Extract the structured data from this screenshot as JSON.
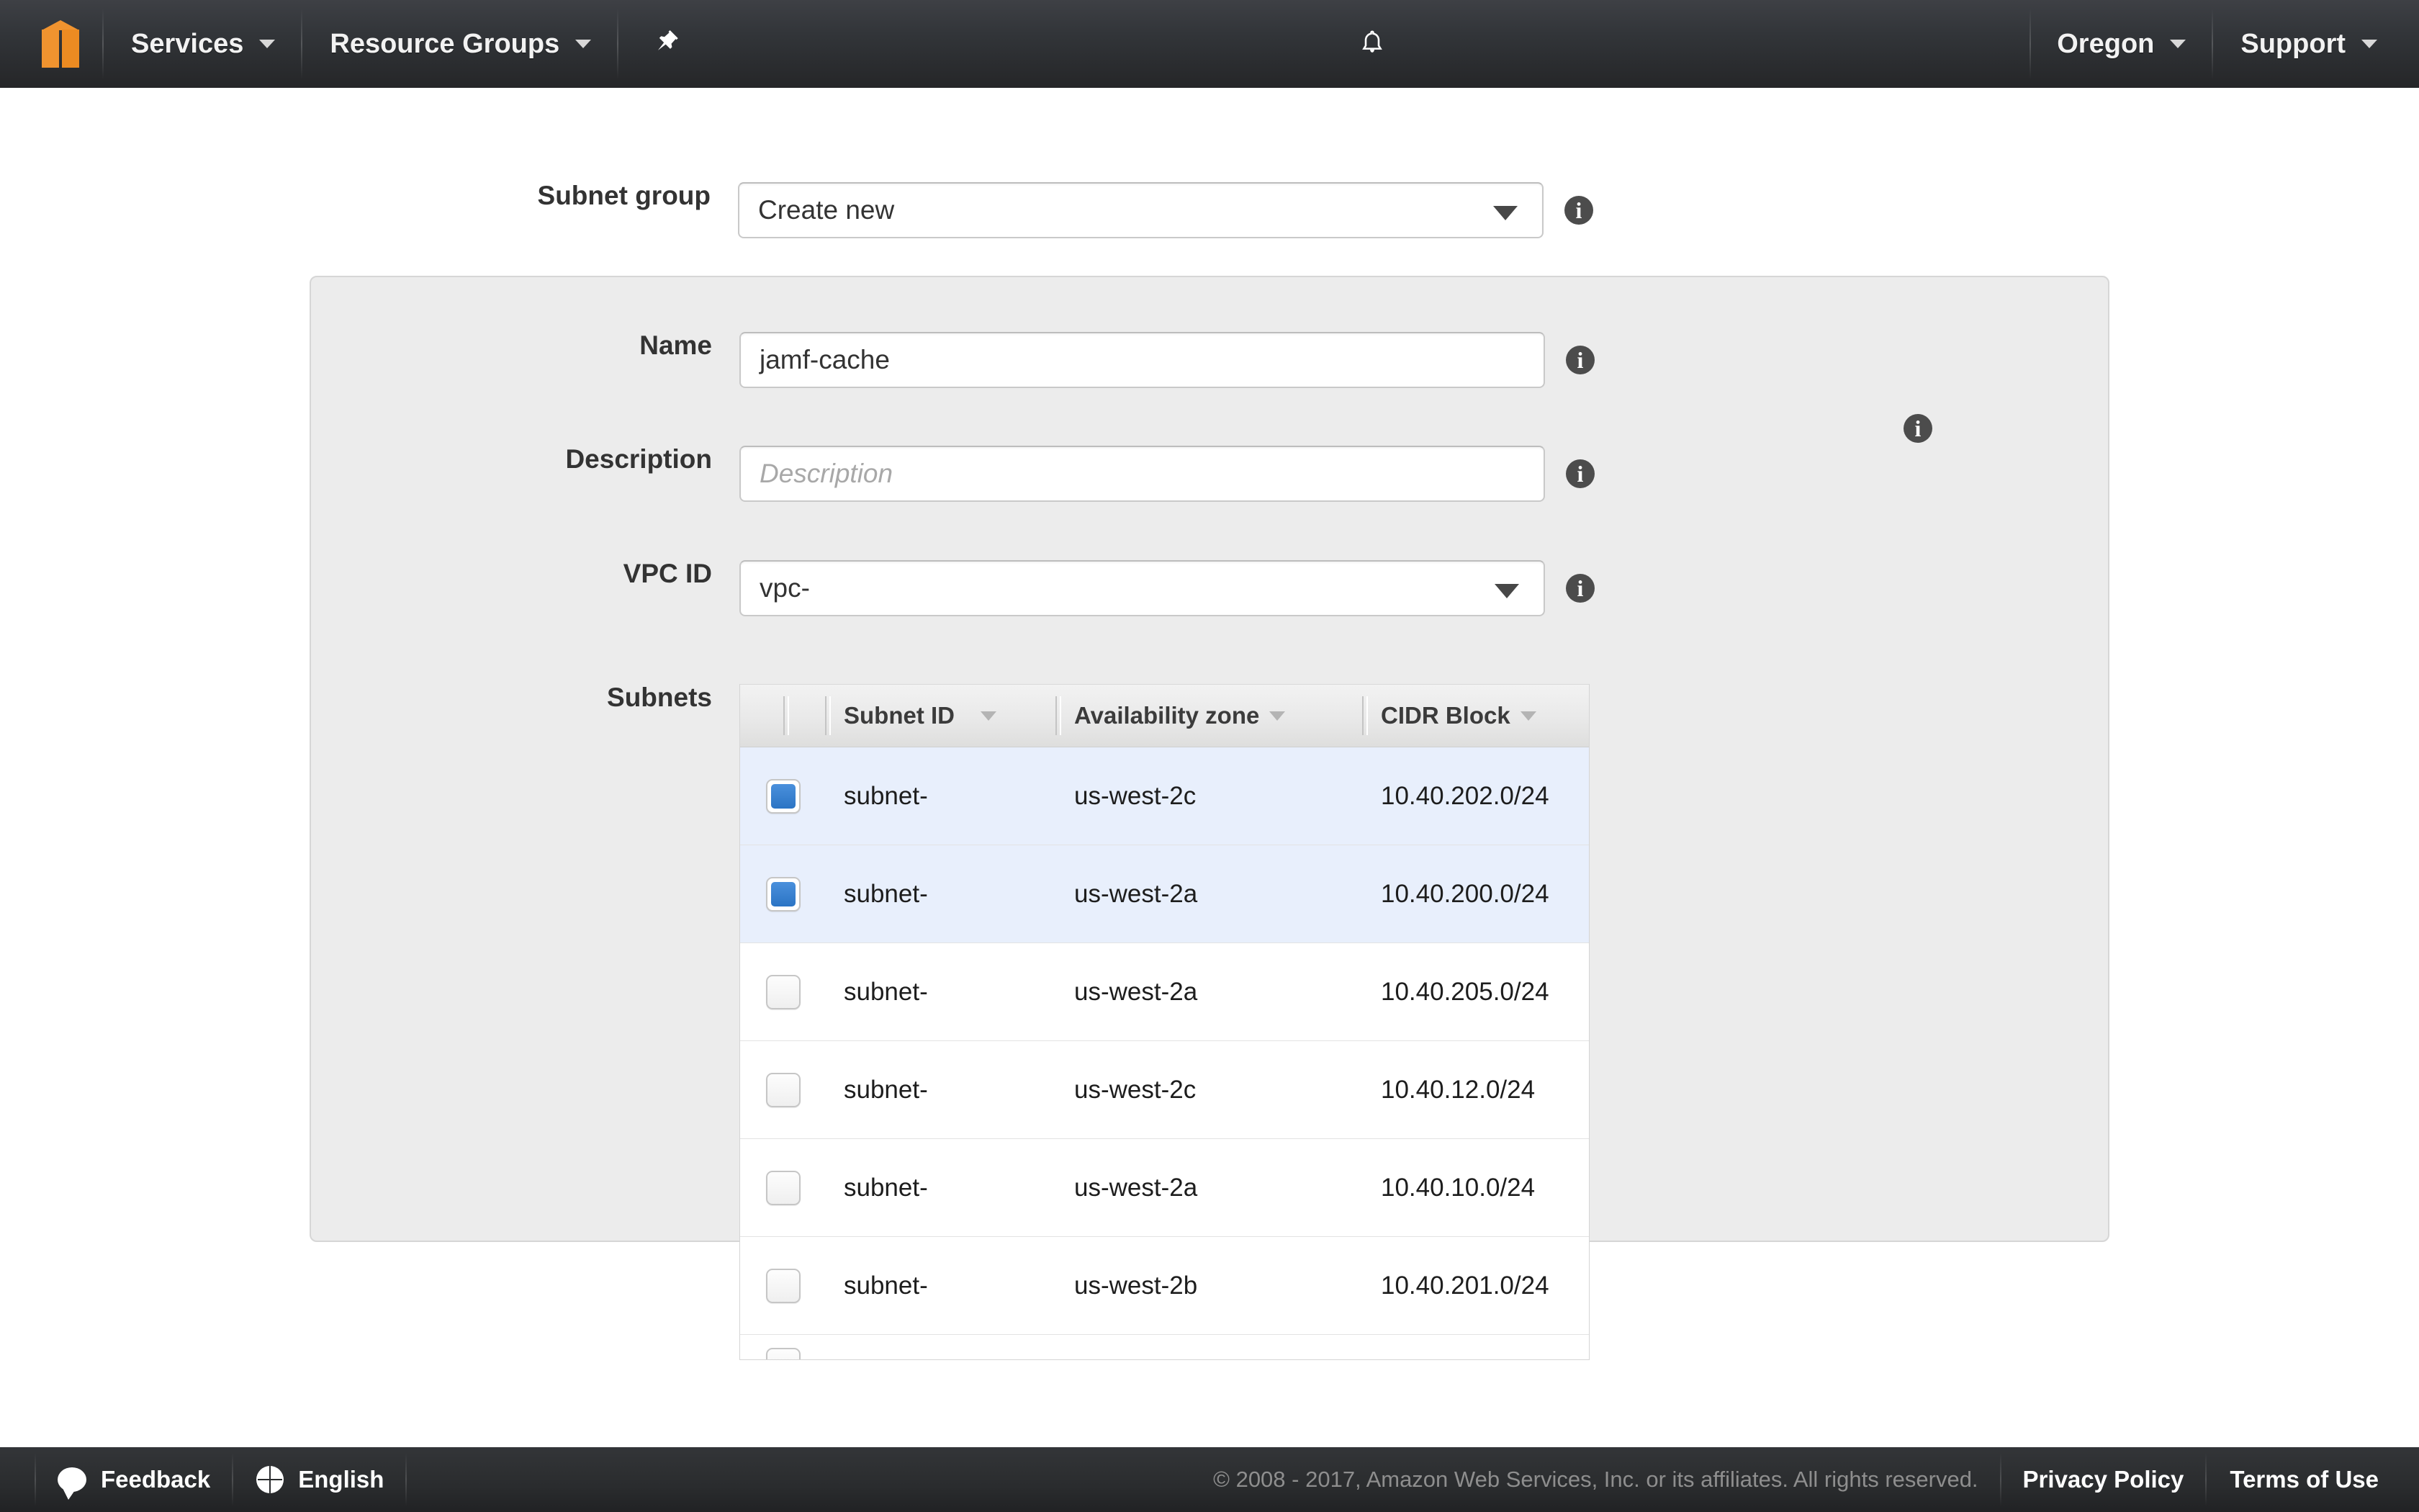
{
  "navbar": {
    "logo_icon": "aws-cube-logo",
    "services_label": "Services",
    "resource_groups_label": "Resource Groups",
    "pin_icon": "pushpin-icon",
    "bell_icon": "bell-notification-icon",
    "region_label": "Oregon",
    "support_label": "Support"
  },
  "form": {
    "subnet_group": {
      "label": "Subnet group",
      "value": "Create new",
      "info_icon": "info-icon"
    },
    "name": {
      "label": "Name",
      "value": "jamf-cache",
      "info_icon": "info-icon"
    },
    "description": {
      "label": "Description",
      "value": "",
      "placeholder": "Description",
      "info_icon": "info-icon"
    },
    "vpc_id": {
      "label": "VPC ID",
      "value": "vpc-",
      "info_icon": "info-icon"
    },
    "subnets": {
      "label": "Subnets",
      "info_icon": "info-icon"
    }
  },
  "subnets_table": {
    "columns": [
      {
        "key": "subnet_id",
        "label": "Subnet ID"
      },
      {
        "key": "availability_zone",
        "label": "Availability zone"
      },
      {
        "key": "cidr_block",
        "label": "CIDR Block"
      }
    ],
    "rows": [
      {
        "selected": true,
        "subnet_id": "subnet-",
        "availability_zone": "us-west-2c",
        "cidr_block": "10.40.202.0/24"
      },
      {
        "selected": true,
        "subnet_id": "subnet-",
        "availability_zone": "us-west-2a",
        "cidr_block": "10.40.200.0/24"
      },
      {
        "selected": false,
        "subnet_id": "subnet-",
        "availability_zone": "us-west-2a",
        "cidr_block": "10.40.205.0/24"
      },
      {
        "selected": false,
        "subnet_id": "subnet-",
        "availability_zone": "us-west-2c",
        "cidr_block": "10.40.12.0/24"
      },
      {
        "selected": false,
        "subnet_id": "subnet-",
        "availability_zone": "us-west-2a",
        "cidr_block": "10.40.10.0/24"
      },
      {
        "selected": false,
        "subnet_id": "subnet-",
        "availability_zone": "us-west-2b",
        "cidr_block": "10.40.201.0/24"
      }
    ]
  },
  "footer": {
    "feedback_label": "Feedback",
    "feedback_icon": "speech-bubble-icon",
    "language_label": "English",
    "language_icon": "globe-icon",
    "copyright": "© 2008 - 2017, Amazon Web Services, Inc. or its affiliates. All rights reserved.",
    "privacy_policy_label": "Privacy Policy",
    "terms_label": "Terms of Use"
  },
  "colors": {
    "nav_dark": "#323539",
    "accent_orange": "#f0932f",
    "selected_row": "#e8effc",
    "checkbox_blue": "#2b74c4",
    "panel_bg": "#ececec"
  }
}
